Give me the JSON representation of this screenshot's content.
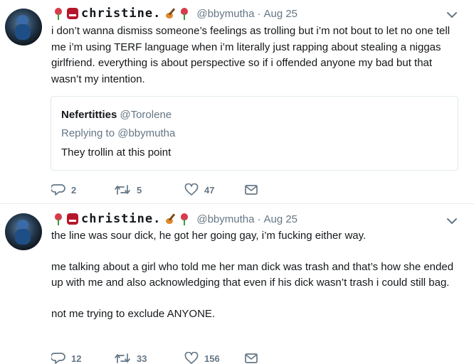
{
  "tweets": [
    {
      "display_name": "christine.",
      "handle": "@bbymutha",
      "separator": "·",
      "date": "Aug 25",
      "paragraphs": [
        "i don’t wanna dismiss someone’s feelings as trolling but i’m not bout to let no one tell me i’m using TERF language when i’m literally just rapping about stealing a niggas girlfriend. everything is about perspective so if i offended anyone my bad but that wasn’t my intention."
      ],
      "quote": {
        "name": "Nefertitties",
        "handle": "@Torolene",
        "replying": "Replying to @bbymutha",
        "text": "They trollin at this point"
      },
      "replies": "2",
      "retweets": "5",
      "likes": "47"
    },
    {
      "display_name": "christine.",
      "handle": "@bbymutha",
      "separator": "·",
      "date": "Aug 25",
      "paragraphs": [
        "the line was sour dick, he got her going gay, i’m fucking either way.",
        "me talking about a girl who told me her man dick was trash and that’s how she ended up with me and also acknowledging that even if his dick wasn’t trash i could still bag.",
        "not me trying to exclude ANYONE."
      ],
      "replies": "12",
      "retweets": "33",
      "likes": "156"
    }
  ],
  "icons": {
    "name_emoji_before": [
      "rose-icon",
      "ogre-icon"
    ],
    "name_emoji_after": [
      "guitar-icon",
      "rose-icon"
    ],
    "caret": "chevron-down-icon",
    "reply": "reply-icon",
    "retweet": "retweet-icon",
    "like": "heart-icon",
    "dm": "envelope-icon"
  },
  "colors": {
    "text": "#14171a",
    "secondary": "#657786",
    "border": "#e6ecf0"
  }
}
